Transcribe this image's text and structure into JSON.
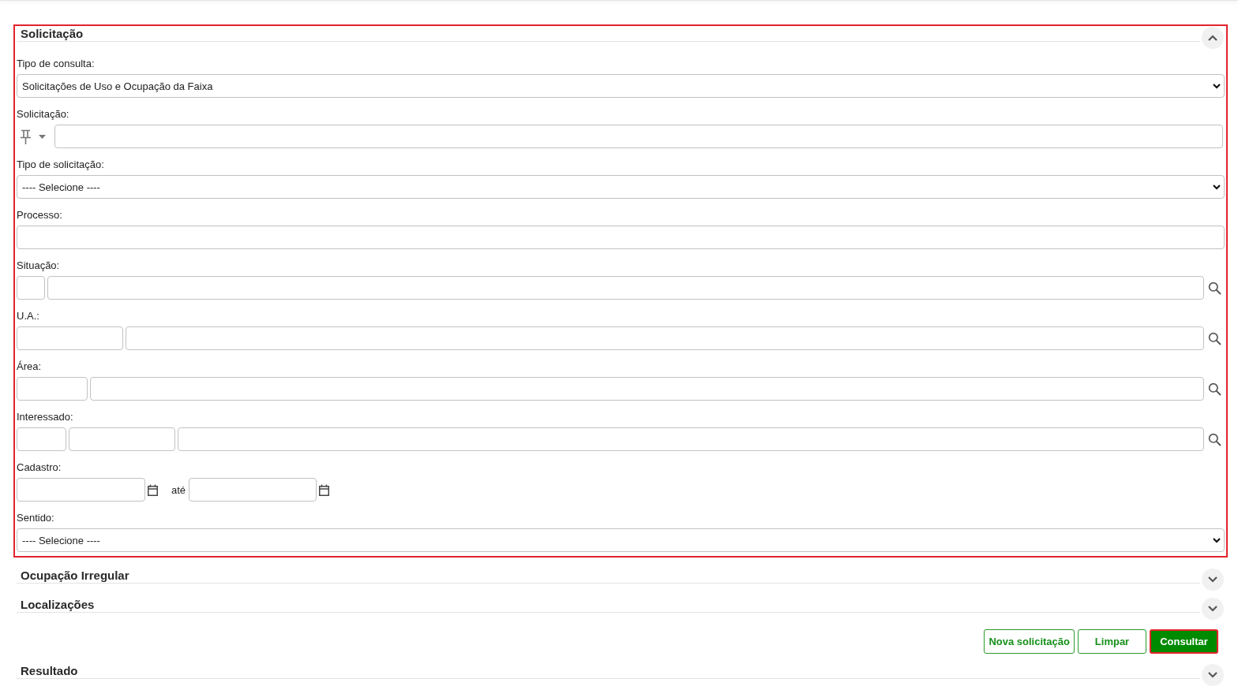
{
  "sections": [
    {
      "title": "Solicitação",
      "expanded": true,
      "highlighted": true,
      "fields": [
        {
          "kind": "select",
          "label": "Tipo de consulta:",
          "value": "Solicitações de Uso e Ocupação da Faixa"
        },
        {
          "kind": "pinned_input",
          "label": "Solicitação:"
        },
        {
          "kind": "select",
          "label": "Tipo de solicitação:",
          "value": "---- Selecione ----"
        },
        {
          "kind": "input",
          "label": "Processo:"
        },
        {
          "kind": "lookup",
          "label": "Situação:",
          "inputs": [
            {
              "kind": "code"
            },
            {
              "kind": "description"
            }
          ]
        },
        {
          "kind": "lookup",
          "label": "U.A.:",
          "inputs": [
            {
              "kind": "code"
            },
            {
              "kind": "description"
            }
          ]
        },
        {
          "kind": "lookup",
          "label": "Área:",
          "inputs": [
            {
              "kind": "code"
            },
            {
              "kind": "description"
            }
          ]
        },
        {
          "kind": "lookup",
          "label": "Interessado:",
          "inputs": [
            {
              "kind": "code"
            },
            {
              "kind": "code"
            },
            {
              "kind": "description"
            }
          ]
        },
        {
          "kind": "date_range",
          "label": "Cadastro:",
          "separator": "até"
        },
        {
          "kind": "select",
          "label": "Sentido:",
          "value": "---- Selecione ----"
        }
      ]
    },
    {
      "title": "Ocupação Irregular",
      "expanded": false,
      "highlighted": false
    },
    {
      "title": "Localizações",
      "expanded": false,
      "highlighted": false
    }
  ],
  "buttons": [
    {
      "label": "Nova solicitação",
      "kind": "outline",
      "highlighted": false
    },
    {
      "label": "Limpar",
      "kind": "outline",
      "highlighted": false
    },
    {
      "label": "Consultar",
      "kind": "primary",
      "highlighted": true
    }
  ],
  "result_section": {
    "title": "Resultado",
    "expanded": false,
    "highlighted": false
  }
}
